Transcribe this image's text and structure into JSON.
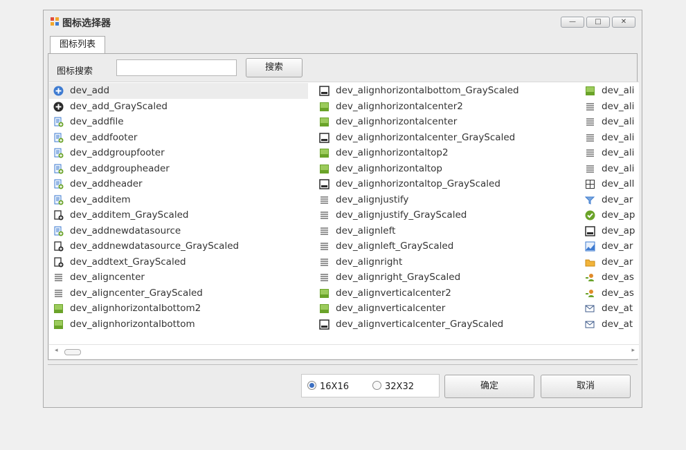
{
  "window": {
    "title": "图标选择器",
    "controls": {
      "minimize": "—",
      "maximize": "□",
      "close": "✕"
    }
  },
  "tabs": [
    {
      "label": "图标列表",
      "active": true
    }
  ],
  "search": {
    "label": "图标搜索",
    "value": "",
    "placeholder": "",
    "button": "搜索"
  },
  "icon_list": {
    "selected": "dev_add",
    "columns": [
      [
        {
          "name": "dev_add",
          "icon": "add-circle-icon"
        },
        {
          "name": "dev_add_GrayScaled",
          "icon": "add-circle-dark-icon"
        },
        {
          "name": "dev_addfile",
          "icon": "add-file-icon"
        },
        {
          "name": "dev_addfooter",
          "icon": "add-footer-icon"
        },
        {
          "name": "dev_addgroupfooter",
          "icon": "add-group-footer-icon"
        },
        {
          "name": "dev_addgroupheader",
          "icon": "add-group-header-icon"
        },
        {
          "name": "dev_addheader",
          "icon": "add-header-icon"
        },
        {
          "name": "dev_additem",
          "icon": "add-item-icon"
        },
        {
          "name": "dev_additem_GrayScaled",
          "icon": "add-item-gray-icon"
        },
        {
          "name": "dev_addnewdatasource",
          "icon": "add-datasource-icon"
        },
        {
          "name": "dev_addnewdatasource_GrayScaled",
          "icon": "add-datasource-gray-icon"
        },
        {
          "name": "dev_addtext_GrayScaled",
          "icon": "add-text-gray-icon"
        },
        {
          "name": "dev_aligncenter",
          "icon": "align-center-icon"
        },
        {
          "name": "dev_aligncenter_GrayScaled",
          "icon": "align-center-gray-icon"
        },
        {
          "name": "dev_alignhorizontalbottom2",
          "icon": "align-horizontal-bottom2-icon"
        },
        {
          "name": "dev_alignhorizontalbottom",
          "icon": "align-horizontal-bottom-icon"
        }
      ],
      [
        {
          "name": "dev_alignhorizontalbottom_GrayScaled",
          "icon": "align-horizontal-bottom-gray-icon"
        },
        {
          "name": "dev_alignhorizontalcenter2",
          "icon": "align-horizontal-center2-icon"
        },
        {
          "name": "dev_alignhorizontalcenter",
          "icon": "align-horizontal-center-icon"
        },
        {
          "name": "dev_alignhorizontalcenter_GrayScaled",
          "icon": "align-horizontal-center-gray-icon"
        },
        {
          "name": "dev_alignhorizontaltop2",
          "icon": "align-horizontal-top2-icon"
        },
        {
          "name": "dev_alignhorizontaltop",
          "icon": "align-horizontal-top-icon"
        },
        {
          "name": "dev_alignhorizontaltop_GrayScaled",
          "icon": "align-horizontal-top-gray-icon"
        },
        {
          "name": "dev_alignjustify",
          "icon": "align-justify-icon"
        },
        {
          "name": "dev_alignjustify_GrayScaled",
          "icon": "align-justify-gray-icon"
        },
        {
          "name": "dev_alignleft",
          "icon": "align-left-icon"
        },
        {
          "name": "dev_alignleft_GrayScaled",
          "icon": "align-left-gray-icon"
        },
        {
          "name": "dev_alignright",
          "icon": "align-right-icon"
        },
        {
          "name": "dev_alignright_GrayScaled",
          "icon": "align-right-gray-icon"
        },
        {
          "name": "dev_alignverticalcenter2",
          "icon": "align-vertical-center2-icon"
        },
        {
          "name": "dev_alignverticalcenter",
          "icon": "align-vertical-center-icon"
        },
        {
          "name": "dev_alignverticalcenter_GrayScaled",
          "icon": "align-vertical-center-gray-icon"
        }
      ],
      [
        {
          "name": "dev_ali",
          "icon": "align-bars-icon"
        },
        {
          "name": "dev_ali",
          "icon": "align-left-green-icon"
        },
        {
          "name": "dev_ali",
          "icon": "align-left-gray-icon"
        },
        {
          "name": "dev_ali",
          "icon": "align-right-bars-icon"
        },
        {
          "name": "dev_ali",
          "icon": "align-right-green-icon"
        },
        {
          "name": "dev_ali",
          "icon": "align-right-gray-icon"
        },
        {
          "name": "dev_all",
          "icon": "all-borders-icon"
        },
        {
          "name": "dev_ar",
          "icon": "filter-arrow-icon"
        },
        {
          "name": "dev_ap",
          "icon": "apply-green-icon"
        },
        {
          "name": "dev_ap",
          "icon": "apply-gray-icon"
        },
        {
          "name": "dev_ar",
          "icon": "area-chart-icon"
        },
        {
          "name": "dev_ar",
          "icon": "archive-folder-icon"
        },
        {
          "name": "dev_as",
          "icon": "assign-user-icon"
        },
        {
          "name": "dev_as",
          "icon": "assign-users-icon"
        },
        {
          "name": "dev_at",
          "icon": "attach-icon"
        },
        {
          "name": "dev_at",
          "icon": "attach-mail-icon"
        }
      ]
    ]
  },
  "scrollbar": {
    "left_arrow": "◂",
    "right_arrow": "▸"
  },
  "size_options": [
    {
      "label": "16X16",
      "selected": true
    },
    {
      "label": "32X32",
      "selected": false
    }
  ],
  "buttons": {
    "ok": "确定",
    "cancel": "取消"
  },
  "colors": {
    "accent": "#3b6fc2",
    "green": "#6aa329",
    "blue": "#3e7bd1",
    "dark": "#2b2b2b"
  }
}
